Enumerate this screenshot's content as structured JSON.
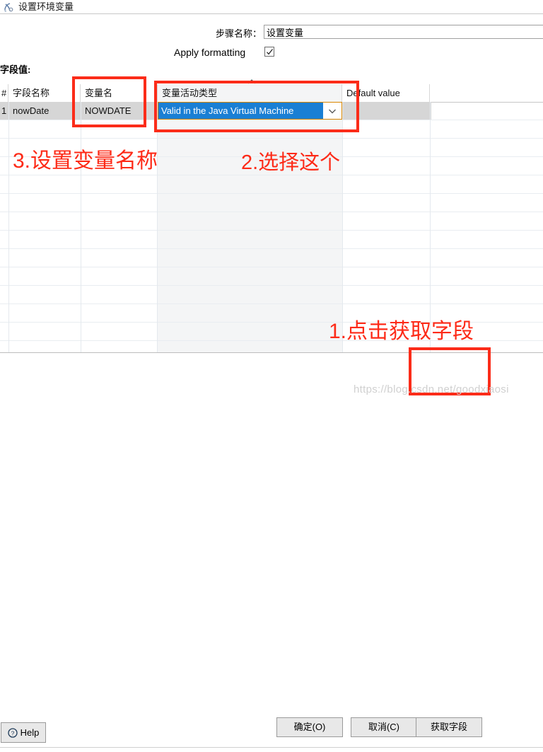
{
  "window": {
    "title": "设置环境变量",
    "icon": "variable-icon"
  },
  "form": {
    "step_name_label": "步骤名称：",
    "step_name_value": "设置变量",
    "apply_formatting_label": "Apply formatting",
    "apply_formatting_checked": "✓"
  },
  "fields_section": {
    "label": "字段值:",
    "sort_indicator": "ascending"
  },
  "table": {
    "columns": [
      {
        "key": "num",
        "header": "#"
      },
      {
        "key": "fieldname",
        "header": "字段名称"
      },
      {
        "key": "varname",
        "header": "变量名"
      },
      {
        "key": "vartype",
        "header": "变量活动类型"
      },
      {
        "key": "default",
        "header": "Default value"
      }
    ],
    "rows": [
      {
        "num": "1",
        "fieldname": "nowDate",
        "varname": "NOWDATE",
        "vartype": "Valid in the Java Virtual Machine",
        "default": ""
      }
    ],
    "dropdown": {
      "selected": "Valid in the Java Virtual Machine",
      "arrow_icon": "chevron-down-icon"
    }
  },
  "buttons": {
    "ok": "确定(O)",
    "cancel": "取消(C)",
    "get_fields": "获取字段",
    "help": "Help",
    "help_icon": "question-circle-icon"
  },
  "annotations": {
    "step1": "1.点击获取字段",
    "step2": "2.选择这个",
    "step3": "3.设置变量名称",
    "color": "#fd2a17"
  },
  "watermark": "https://blog.csdn.net/goodxiaosi"
}
